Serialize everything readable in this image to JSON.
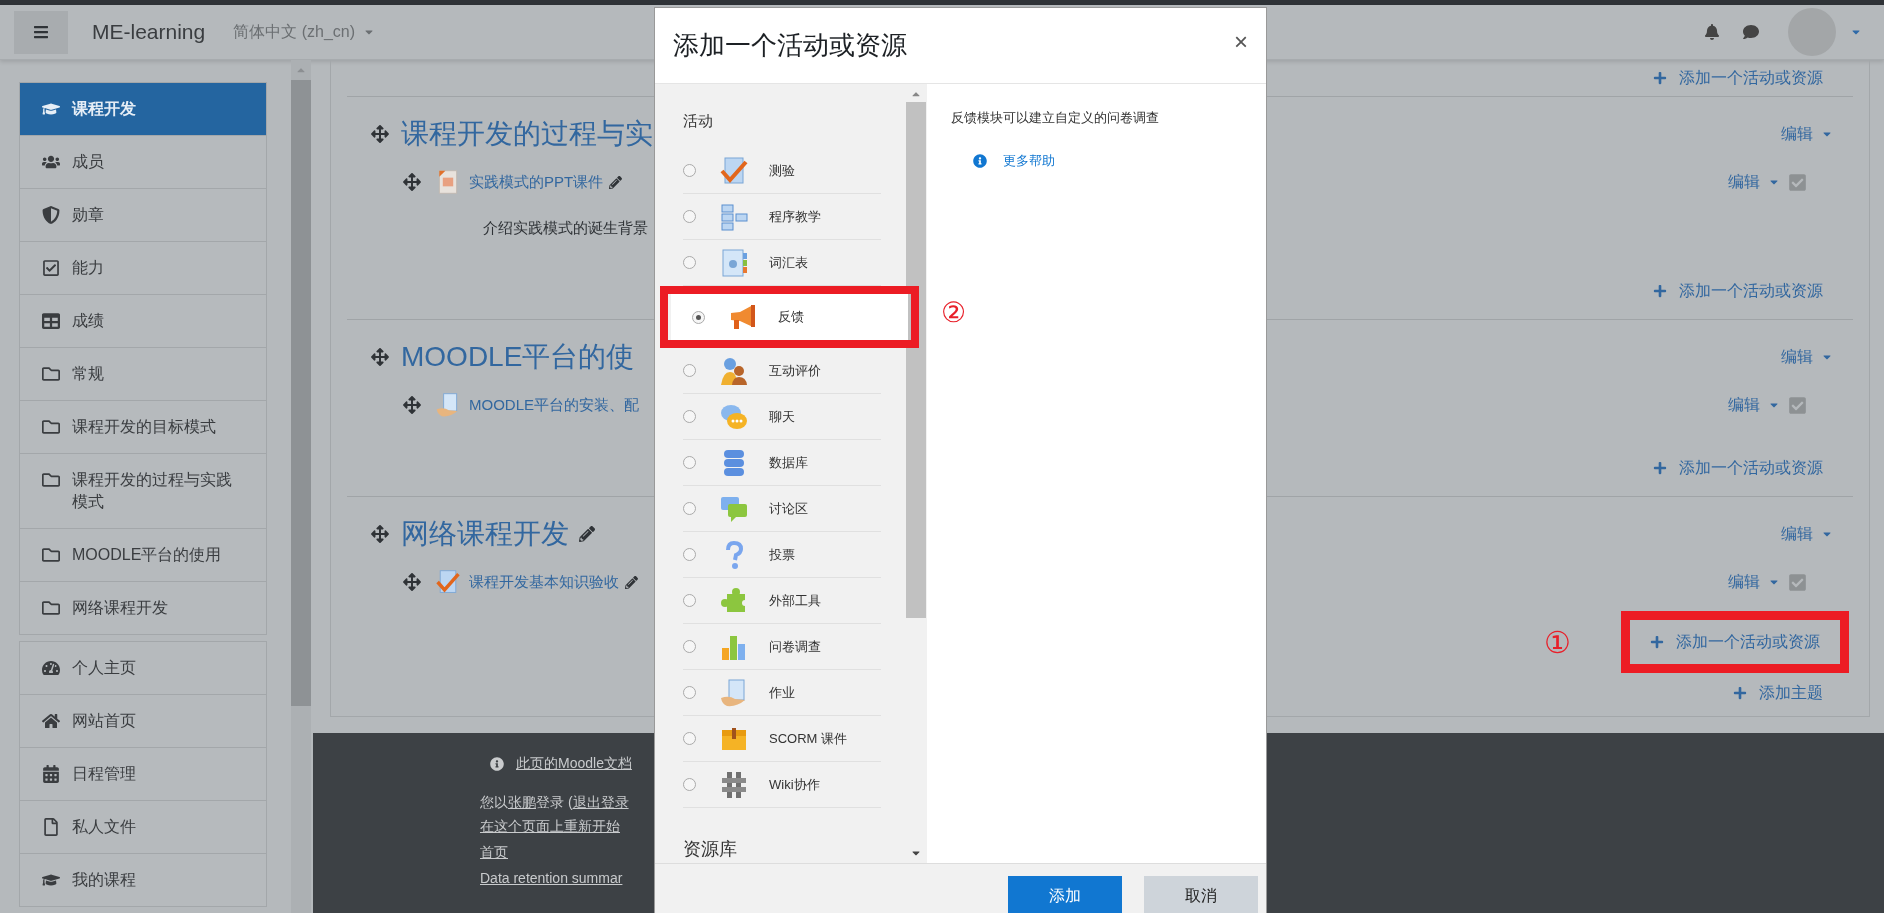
{
  "navbar": {
    "brand": "ME-learning",
    "language": "简体中文 (zh_cn)"
  },
  "sidebar": {
    "groups": [
      {
        "items": [
          {
            "label": "课程开发",
            "kind": "course",
            "selected": true
          },
          {
            "label": "成员",
            "kind": "participants",
            "selected": false
          },
          {
            "label": "勋章",
            "kind": "badges",
            "selected": false
          },
          {
            "label": "能力",
            "kind": "competencies",
            "selected": false
          },
          {
            "label": "成绩",
            "kind": "grades",
            "selected": false
          },
          {
            "label": "常规",
            "kind": "folder",
            "selected": false
          },
          {
            "label": "课程开发的目标模式",
            "kind": "folder",
            "selected": false
          },
          {
            "label": "课程开发的过程与实践模式",
            "kind": "folder",
            "selected": false
          },
          {
            "label": "MOODLE平台的使用",
            "kind": "folder",
            "selected": false
          },
          {
            "label": "网络课程开发",
            "kind": "folder",
            "selected": false
          }
        ]
      },
      {
        "items": [
          {
            "label": "个人主页",
            "kind": "dashboard",
            "selected": false
          },
          {
            "label": "网站首页",
            "kind": "home",
            "selected": false
          },
          {
            "label": "日程管理",
            "kind": "calendar",
            "selected": false
          },
          {
            "label": "私人文件",
            "kind": "files",
            "selected": false
          },
          {
            "label": "我的课程",
            "kind": "course",
            "selected": false
          }
        ]
      }
    ]
  },
  "course": {
    "top_add_link": "添加一个活动或资源",
    "sections": [
      {
        "title": "课程开发的过程与实",
        "pencil": false,
        "edit_menu": "编辑",
        "activities": [
          {
            "name": "实践模式的PPT课件",
            "kind": "ppt",
            "pencil": true,
            "edit_menu": "编辑",
            "description": "介绍实践模式的诞生背景"
          }
        ],
        "add_link": "添加一个活动或资源"
      },
      {
        "title": "MOODLE平台的使",
        "pencil": false,
        "edit_menu": "编辑",
        "activities": [
          {
            "name": "MOODLE平台的安装、配",
            "kind": "assignment",
            "pencil": false,
            "edit_menu": "编辑"
          }
        ],
        "add_link": "添加一个活动或资源"
      },
      {
        "title": "网络课程开发",
        "pencil": true,
        "edit_menu": "编辑",
        "activities": [
          {
            "name": "课程开发基本知识验收",
            "kind": "quiz",
            "pencil": true,
            "edit_menu": "编辑"
          }
        ],
        "add_link": "添加一个活动或资源",
        "marker": "①"
      }
    ],
    "add_topic": "添加主题"
  },
  "footer": {
    "doc_link": "此页的Moodle文档",
    "login_line": [
      {
        "text": "您以",
        "link": false
      },
      {
        "text": "张鹏",
        "link": true
      },
      {
        "text": "登录 (",
        "link": false
      },
      {
        "text": "退出登录",
        "link": true
      }
    ],
    "links": [
      "在这个页面上重新开始",
      "首页",
      "Data retention summar"
    ]
  },
  "modal": {
    "title": "添加一个活动或资源",
    "close": "×",
    "groups": [
      {
        "heading": "活动",
        "items": [
          {
            "label": "测验",
            "kind": "quiz",
            "selected": false
          },
          {
            "label": "程序教学",
            "kind": "lesson",
            "selected": false
          },
          {
            "label": "词汇表",
            "kind": "glossary",
            "selected": false
          },
          {
            "label": "反馈",
            "kind": "feedback",
            "selected": true,
            "marker": "②"
          },
          {
            "label": "互动评价",
            "kind": "workshop",
            "selected": false
          },
          {
            "label": "聊天",
            "kind": "chat",
            "selected": false
          },
          {
            "label": "数据库",
            "kind": "database",
            "selected": false
          },
          {
            "label": "讨论区",
            "kind": "forum",
            "selected": false
          },
          {
            "label": "投票",
            "kind": "choice",
            "selected": false
          },
          {
            "label": "外部工具",
            "kind": "lti",
            "selected": false
          },
          {
            "label": "问卷调查",
            "kind": "survey",
            "selected": false
          },
          {
            "label": "作业",
            "kind": "assignment",
            "selected": false
          },
          {
            "label": "SCORM 课件",
            "kind": "scorm",
            "selected": false
          },
          {
            "label": "Wiki协作",
            "kind": "wiki",
            "selected": false
          }
        ]
      },
      {
        "heading": "资源库"
      }
    ],
    "description": "反馈模块可以建立自定义的问卷调查",
    "help_link": "更多帮助",
    "buttons": [
      {
        "label": "添加",
        "kind": "primary"
      },
      {
        "label": "取消",
        "kind": "secondary"
      }
    ]
  }
}
